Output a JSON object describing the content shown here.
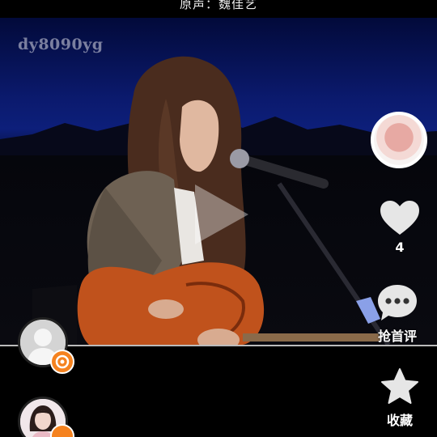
{
  "header": {
    "caption": "原声：魏佳艺"
  },
  "video": {
    "watermark": "dy8090yg",
    "state": "paused"
  },
  "rail": {
    "music_disc": {
      "icon": "album-cover"
    },
    "like": {
      "count": "4",
      "icon": "heart-icon"
    },
    "comment": {
      "label": "抢首评",
      "icon": "comment-icon"
    },
    "favorite": {
      "label": "收藏",
      "icon": "star-icon"
    }
  },
  "users": [
    {
      "avatar": "default-avatar",
      "badge": "live-badge"
    },
    {
      "avatar": "girl-avatar",
      "badge": "live-badge"
    }
  ],
  "colors": {
    "accent": "#f5821f",
    "background": "#000000"
  }
}
